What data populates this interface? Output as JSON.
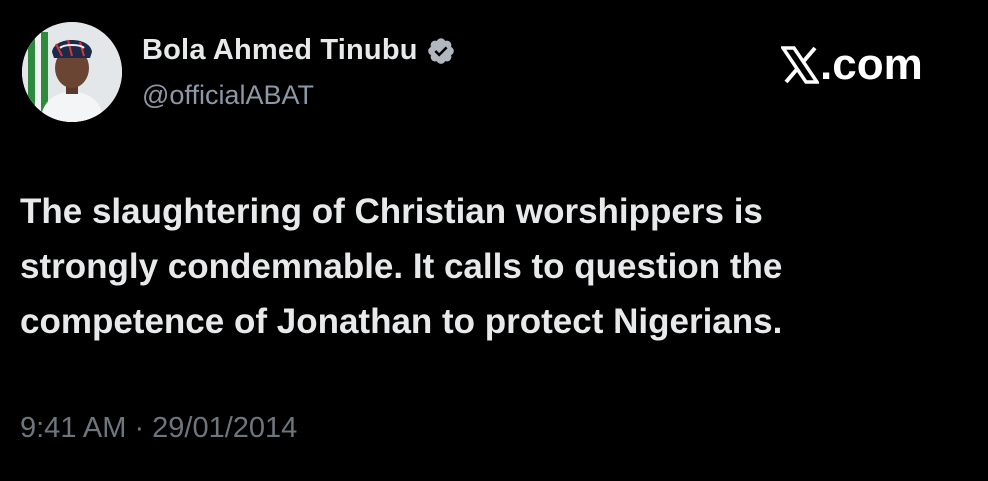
{
  "author": {
    "display_name": "Bola Ahmed Tinubu",
    "handle": "@officialABAT",
    "verified": true,
    "avatar_icon": "profile-photo"
  },
  "watermark": {
    "logo_icon": "x-logo-icon",
    "text": ".com"
  },
  "tweet": {
    "text": "The slaughtering of Christian worshippers  is\nstrongly condemnable. It calls to question the\ncompetence of Jonathan to protect Nigerians.",
    "timestamp": "9:41 AM · 29/01/2014"
  },
  "colors": {
    "background": "#000000",
    "primary_text": "#e7e9ea",
    "secondary_text": "#8b98a5",
    "timestamp_text": "#6e767d",
    "verified_badge": "#b0b7bf"
  }
}
